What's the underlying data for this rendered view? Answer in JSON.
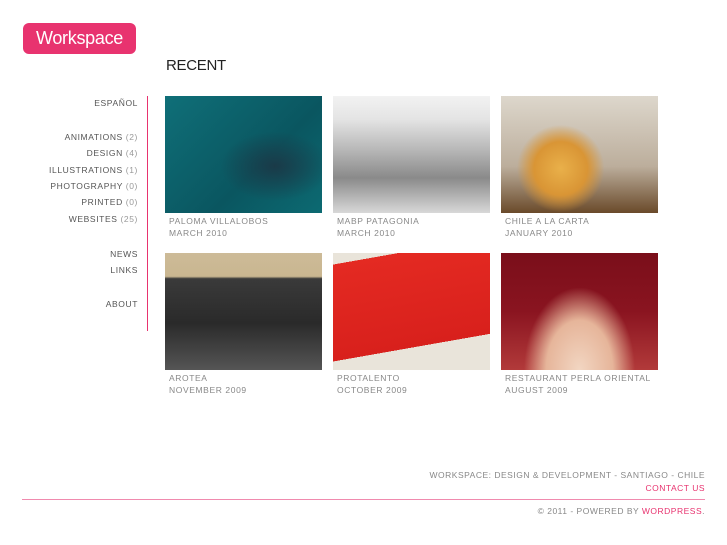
{
  "logo": "Workspace",
  "page_title": "RECENT",
  "sidebar": {
    "language": "ESPAÑOL",
    "categories": [
      {
        "label": "ANIMATIONS",
        "count": "(2)"
      },
      {
        "label": "DESIGN",
        "count": "(4)"
      },
      {
        "label": "ILLUSTRATIONS",
        "count": "(1)"
      },
      {
        "label": "PHOTOGRAPHY",
        "count": "(0)"
      },
      {
        "label": "PRINTED",
        "count": "(0)"
      },
      {
        "label": "WEBSITES",
        "count": "(25)"
      }
    ],
    "news": "NEWS",
    "links": "LINKS",
    "about": "ABOUT"
  },
  "projects": [
    {
      "title": "PALOMA VILLALOBOS",
      "date": "MARCH 2010"
    },
    {
      "title": "MABP PATAGONIA",
      "date": "MARCH 2010"
    },
    {
      "title": "CHILE A LA CARTA",
      "date": "JANUARY 2010"
    },
    {
      "title": "AROTEA",
      "date": "NOVEMBER 2009"
    },
    {
      "title": "PROTALENTO",
      "date": "OCTOBER 2009"
    },
    {
      "title": "RESTAURANT PERLA ORIENTAL",
      "date": "AUGUST 2009"
    }
  ],
  "footer": {
    "tagline": "WORKSPACE: DESIGN & DEVELOPMENT - SANTIAGO - CHILE",
    "contact": "CONTACT US",
    "copyright": "© 2011 - POWERED BY ",
    "wordpress": "WORDPRESS",
    "period": "."
  },
  "colors": {
    "accent": "#e8336f"
  }
}
